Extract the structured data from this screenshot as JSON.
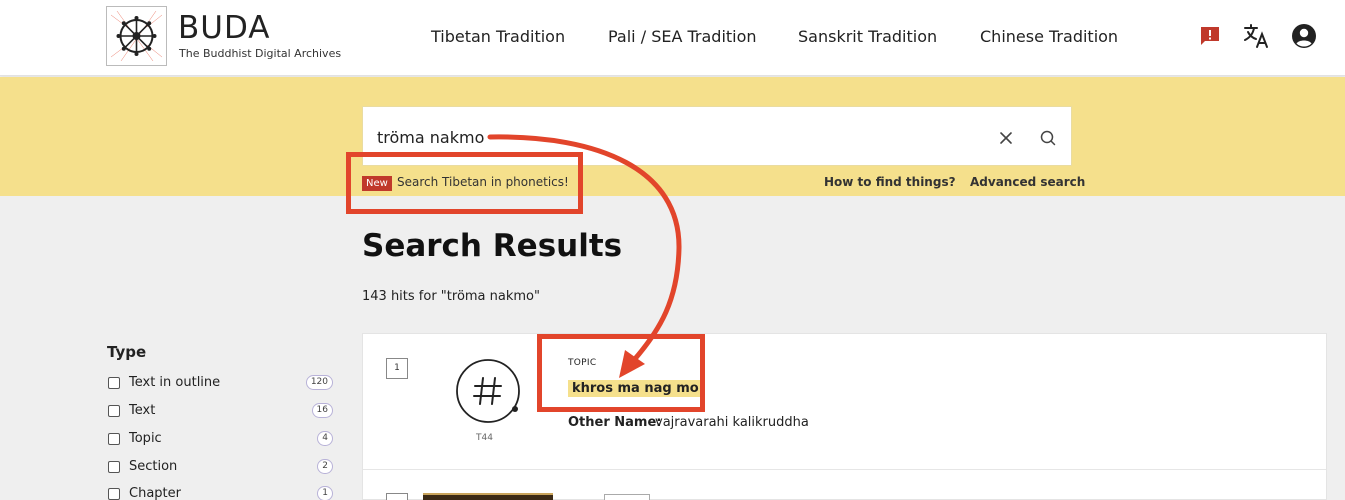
{
  "header": {
    "logo_title": "BUDA",
    "logo_subtitle": "The Buddhist Digital Archives",
    "nav": [
      "Tibetan Tradition",
      "Pali / SEA Tradition",
      "Sanskrit Tradition",
      "Chinese Tradition"
    ],
    "icons": [
      "feedback-icon",
      "translate-icon",
      "account-icon"
    ]
  },
  "search": {
    "query": "tröma nakmo",
    "new_badge": "New",
    "new_text": "Search Tibetan in phonetics!",
    "how_to_find": "How to find things?",
    "advanced": "Advanced search"
  },
  "results": {
    "title": "Search Results",
    "hits": "143 hits for \"tröma nakmo\""
  },
  "sidebar": {
    "facet_title": "Type",
    "items": [
      {
        "label": "Text in outline",
        "count": "120"
      },
      {
        "label": "Text",
        "count": "16"
      },
      {
        "label": "Topic",
        "count": "4"
      },
      {
        "label": "Section",
        "count": "2"
      },
      {
        "label": "Chapter",
        "count": "1"
      }
    ]
  },
  "result1": {
    "number": "1",
    "code": "T44",
    "kind": "TOPIC",
    "name": "khros ma nag mo",
    "other_name_label": "Other Name:",
    "other_name_value": "vajravarahi kalikruddha"
  },
  "colors": {
    "accent_yellow": "#f5e08c",
    "annotation_red": "#e2452b",
    "badge_red": "#c0392b",
    "feedback_red": "#c0392b"
  }
}
